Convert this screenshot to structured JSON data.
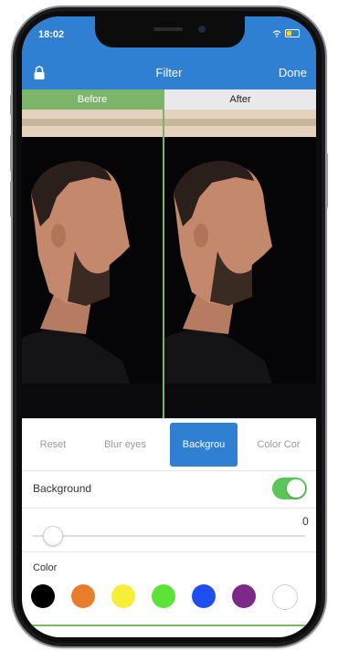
{
  "status": {
    "time": "18:02"
  },
  "nav": {
    "title": "Filter",
    "done_label": "Done",
    "left_icon": "lock-icon"
  },
  "compare": {
    "before_label": "Before",
    "after_label": "After"
  },
  "tools": [
    {
      "label": "Reset",
      "active": false
    },
    {
      "label": "Blur eyes",
      "active": false
    },
    {
      "label": "Backgrou",
      "active": true
    },
    {
      "label": "Color Cor",
      "active": false
    }
  ],
  "background": {
    "label": "Background",
    "enabled": true
  },
  "slider": {
    "value_text": "0",
    "level": 0.04
  },
  "color": {
    "label": "Color",
    "swatches": [
      "#000000",
      "#e97d2e",
      "#f5ef3a",
      "#5be33a",
      "#1e4df0",
      "#7b2a8a",
      "#ffffff"
    ]
  },
  "colors": {
    "accent": "#2f7fd3",
    "green": "#7ab56a",
    "toggle_on": "#5cc55a"
  }
}
